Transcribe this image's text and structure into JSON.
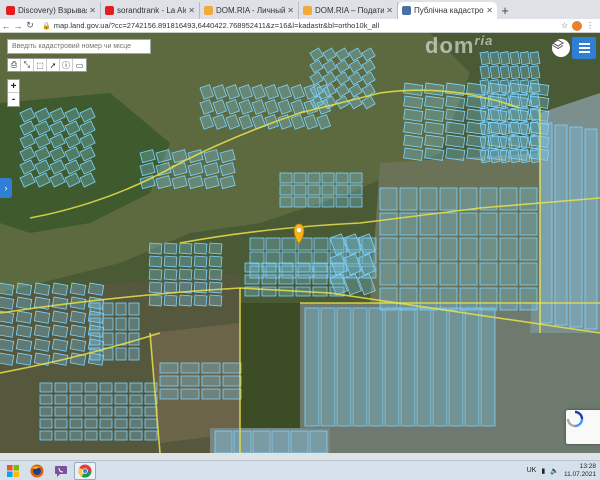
{
  "browser": {
    "tabs": [
      {
        "title": "Discovery) Взрывая историю",
        "favicon_color": "#e02020",
        "active": false
      },
      {
        "title": "sorandtrank - La Alegría",
        "favicon_color": "#e02020",
        "active": false
      },
      {
        "title": "DOM.RIA - Личный кабинет",
        "favicon_color": "#f2a93b",
        "active": false
      },
      {
        "title": "DOM.RIA – Подати оголошен",
        "favicon_color": "#f2a93b",
        "active": false
      },
      {
        "title": "Публічна кадастрова карта",
        "favicon_color": "#4a6fa5",
        "active": true
      }
    ],
    "new_tab_label": "+",
    "url": "map.land.gov.ua/?cc=2742156.891816493,6440422.768952411&z=16&l=kadastr&bl=ortho10k_all",
    "icons": {
      "back": "back-arrow-icon",
      "forward": "forward-arrow-icon",
      "reload": "reload-icon",
      "lock": "lock-icon",
      "star": "star-icon",
      "menu": "kebab-menu-icon"
    }
  },
  "map": {
    "search_placeholder": "Введіть кадастровий номер чи місце",
    "tools": [
      "print-icon",
      "measure-icon",
      "area-icon",
      "cursor-icon",
      "info-icon",
      "layers-toolbar-icon"
    ],
    "zoom_in_label": "+",
    "zoom_out_label": "-",
    "side_toggle_label": "›",
    "watermark": {
      "main": "dom",
      "sub": "ria"
    },
    "marker_color": "#f4b21b",
    "parcel_color": "#7fd3ff",
    "road_color": "#e8e24a"
  },
  "taskbar": {
    "apps": [
      "windows-start-icon",
      "firefox-icon",
      "viber-icon",
      "chrome-icon"
    ],
    "language": "UK",
    "time": "13:28",
    "date": "11.07.2021"
  }
}
